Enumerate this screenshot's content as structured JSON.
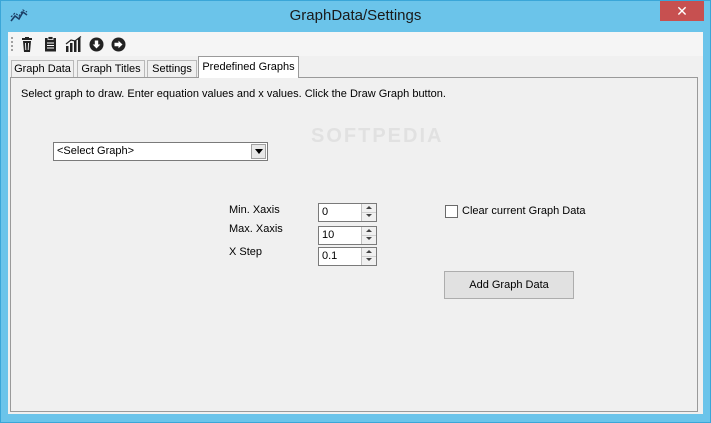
{
  "window": {
    "title": "GraphData/Settings",
    "close_label": "✕"
  },
  "toolbar": {
    "items": [
      "delete-icon",
      "clipboard-icon",
      "chart-icon",
      "arrow-down-icon",
      "arrow-right-icon"
    ]
  },
  "tabs": [
    {
      "label": "Graph Data",
      "active": false
    },
    {
      "label": "Graph Titles",
      "active": false
    },
    {
      "label": "Settings",
      "active": false
    },
    {
      "label": "Predefined Graphs",
      "active": true
    }
  ],
  "panel": {
    "instructions": "Select graph to draw. Enter equation values and x values. Click the Draw Graph button.",
    "graph_select": {
      "value": "<Select Graph>"
    },
    "min_xaxis": {
      "label": "Min. Xaxis",
      "value": "0"
    },
    "max_xaxis": {
      "label": "Max. Xaxis",
      "value": "10"
    },
    "x_step": {
      "label": "X Step",
      "value": "0.1"
    },
    "clear_checkbox": {
      "label": "Clear current Graph Data",
      "checked": false
    },
    "add_button": {
      "label": "Add Graph Data"
    }
  },
  "colors": {
    "titlebar": "#6bc4ea",
    "client": "#f0f0f0",
    "close_button": "#c75050"
  }
}
